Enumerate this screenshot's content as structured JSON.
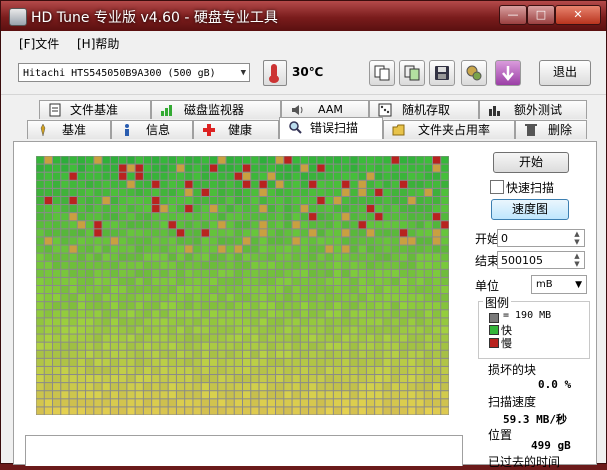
{
  "window": {
    "title": "HD Tune 专业版 v4.60 - 硬盘专业工具",
    "minimize": "—",
    "maximize": "□",
    "close": "✕"
  },
  "menu": {
    "file": "[F]文件",
    "help": "[H]帮助"
  },
  "toolbar": {
    "drive": "Hitachi HTS545050B9A300 (500 gB)",
    "temperature": "30℃",
    "exit_label": "退出"
  },
  "tabs_top": [
    {
      "label": "文件基准",
      "icon": "file-benchmark-icon"
    },
    {
      "label": "磁盘监视器",
      "icon": "disk-monitor-icon"
    },
    {
      "label": "AAM",
      "icon": "speaker-icon"
    },
    {
      "label": "随机存取",
      "icon": "random-access-icon"
    },
    {
      "label": "额外测试",
      "icon": "extra-tests-icon"
    }
  ],
  "tabs_bottom": [
    {
      "label": "基准",
      "icon": "benchmark-icon"
    },
    {
      "label": "信息",
      "icon": "info-icon"
    },
    {
      "label": "健康",
      "icon": "health-cross-icon"
    },
    {
      "label": "错误扫描",
      "icon": "magnifier-icon",
      "active": true
    },
    {
      "label": "文件夹占用率",
      "icon": "folder-icon"
    },
    {
      "label": "删除",
      "icon": "trash-icon"
    }
  ],
  "scan": {
    "start_button": "开始",
    "quick_scan_label": "快速扫描",
    "quick_scan_checked": false,
    "speed_map_button": "速度图",
    "start_label": "开始",
    "start_value": "0",
    "end_label": "结束",
    "end_value": "500105",
    "unit_label": "单位",
    "unit_value": "mB",
    "legend_title": "图例",
    "legend_block": "= 190 MB",
    "legend_fast": "快",
    "legend_slow": "慢",
    "damaged_blocks_label": "损坏的块",
    "damaged_blocks_value": "0.0 %",
    "scan_speed_label": "扫描速度",
    "scan_speed_value": "59.3 MB/秒",
    "position_label": "位置",
    "position_value": "499 gB",
    "elapsed_label": "已过去的时间"
  },
  "colors": {
    "fast": "#34b53a",
    "slow": "#b8231f",
    "block": "#7a7a7a",
    "title_bar": "#7a1c1c"
  }
}
